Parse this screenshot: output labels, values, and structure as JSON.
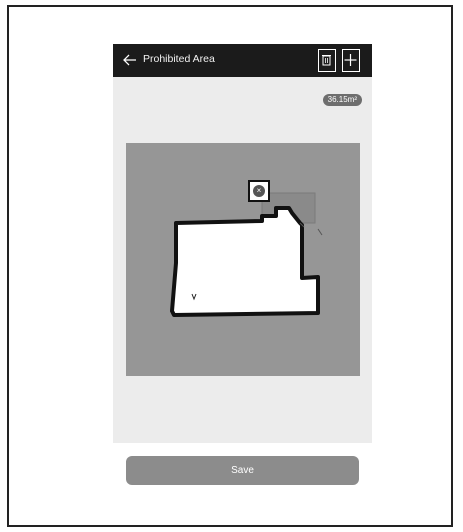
{
  "header": {
    "title": "Prohibited Area",
    "back_icon": "back-arrow-icon",
    "delete_icon": "trash-icon",
    "add_icon": "plus-icon"
  },
  "map": {
    "area_label": "36.15m²",
    "zone_remove_glyph": "×"
  },
  "footer": {
    "save_label": "Save"
  },
  "colors": {
    "header_bg": "#1b1b1b",
    "screen_bg": "#ececec",
    "map_bg": "#969696",
    "floor": "#ffffff",
    "wall": "#111111",
    "save_button_bg": "#8c8c8c"
  }
}
